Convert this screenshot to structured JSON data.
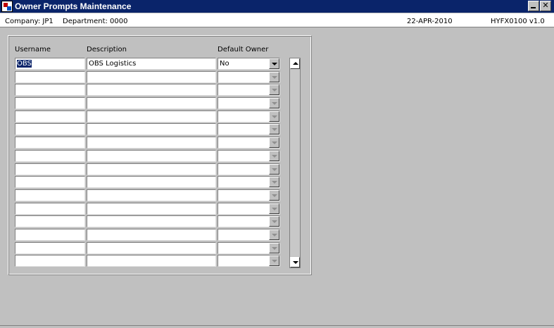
{
  "window": {
    "title": "Owner Prompts Maintenance",
    "minimize_label": "_",
    "close_label": "✕"
  },
  "infobar": {
    "company": "Company:  JP1",
    "department": "Department:  0000",
    "date": "22-APR-2010",
    "form_id": "HYFX0100  v1.0"
  },
  "table": {
    "columns": {
      "username": "Username",
      "description": "Description",
      "default_owner": "Default Owner"
    },
    "rows": [
      {
        "username": "OBS",
        "description": "OBS Logistics",
        "default_owner": "No"
      },
      {
        "username": "",
        "description": "",
        "default_owner": ""
      },
      {
        "username": "",
        "description": "",
        "default_owner": ""
      },
      {
        "username": "",
        "description": "",
        "default_owner": ""
      },
      {
        "username": "",
        "description": "",
        "default_owner": ""
      },
      {
        "username": "",
        "description": "",
        "default_owner": ""
      },
      {
        "username": "",
        "description": "",
        "default_owner": ""
      },
      {
        "username": "",
        "description": "",
        "default_owner": ""
      },
      {
        "username": "",
        "description": "",
        "default_owner": ""
      },
      {
        "username": "",
        "description": "",
        "default_owner": ""
      },
      {
        "username": "",
        "description": "",
        "default_owner": ""
      },
      {
        "username": "",
        "description": "",
        "default_owner": ""
      },
      {
        "username": "",
        "description": "",
        "default_owner": ""
      },
      {
        "username": "",
        "description": "",
        "default_owner": ""
      },
      {
        "username": "",
        "description": "",
        "default_owner": ""
      },
      {
        "username": "",
        "description": "",
        "default_owner": ""
      }
    ]
  },
  "colors": {
    "titlebar": "#0a246a",
    "background": "#c0c0c0",
    "selection": "#0a246a"
  }
}
